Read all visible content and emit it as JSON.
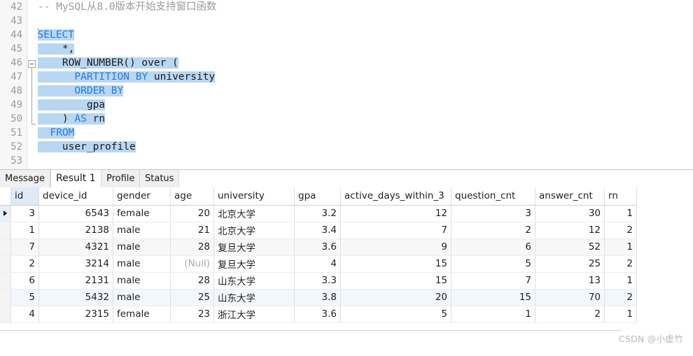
{
  "editor": {
    "lines": [
      {
        "num": "42",
        "indent": 0,
        "selected": false,
        "tokens": [
          {
            "t": "-- MySQL从8.0版本开始支持窗口函数",
            "c": "cmt"
          }
        ]
      },
      {
        "num": "43",
        "indent": 0,
        "selected": false,
        "tokens": []
      },
      {
        "num": "44",
        "indent": 0,
        "selected": true,
        "caret": true,
        "tokens": [
          {
            "t": "SELECT",
            "c": "kw"
          }
        ]
      },
      {
        "num": "45",
        "indent": 0,
        "selected": true,
        "tokens": [
          {
            "t": "    *,",
            "c": "id"
          }
        ]
      },
      {
        "num": "46",
        "indent": 0,
        "selected": true,
        "fold": "start",
        "tokens": [
          {
            "t": "    ROW_NUMBER() over (",
            "c": "id"
          }
        ]
      },
      {
        "num": "47",
        "indent": 0,
        "selected": true,
        "tokens": [
          {
            "t": "      ",
            "c": "id"
          },
          {
            "t": "PARTITION BY",
            "c": "kw"
          },
          {
            "t": " university",
            "c": "id"
          }
        ]
      },
      {
        "num": "48",
        "indent": 0,
        "selected": true,
        "tokens": [
          {
            "t": "      ",
            "c": "id"
          },
          {
            "t": "ORDER BY",
            "c": "kw"
          }
        ]
      },
      {
        "num": "49",
        "indent": 0,
        "selected": true,
        "tokens": [
          {
            "t": "        gpa",
            "c": "id"
          }
        ]
      },
      {
        "num": "50",
        "indent": 0,
        "selected": true,
        "fold": "end",
        "tokens": [
          {
            "t": "    ) ",
            "c": "id"
          },
          {
            "t": "AS",
            "c": "kw"
          },
          {
            "t": " rn",
            "c": "id"
          }
        ]
      },
      {
        "num": "51",
        "indent": 0,
        "selected": true,
        "tokens": [
          {
            "t": "  ",
            "c": "id"
          },
          {
            "t": "FROM",
            "c": "kw"
          }
        ]
      },
      {
        "num": "52",
        "indent": 0,
        "selected": true,
        "tokens": [
          {
            "t": "    user_profile",
            "c": "id"
          }
        ]
      },
      {
        "num": "53",
        "indent": 0,
        "selected": false,
        "tokens": []
      }
    ]
  },
  "tabs": [
    {
      "label": "Message",
      "active": false
    },
    {
      "label": "Result 1",
      "active": true
    },
    {
      "label": "Profile",
      "active": false
    },
    {
      "label": "Status",
      "active": false
    }
  ],
  "grid": {
    "columns": [
      {
        "name": "id",
        "width": 40,
        "align": "num",
        "selected": true
      },
      {
        "name": "device_id",
        "width": 106,
        "align": "num",
        "selected": false
      },
      {
        "name": "gender",
        "width": 82,
        "align": "txt",
        "selected": false
      },
      {
        "name": "age",
        "width": 62,
        "align": "num",
        "selected": false
      },
      {
        "name": "university",
        "width": 115,
        "align": "txt",
        "selected": false
      },
      {
        "name": "gpa",
        "width": 66,
        "align": "num",
        "selected": false
      },
      {
        "name": "active_days_within_3",
        "width": 158,
        "align": "num",
        "selected": false
      },
      {
        "name": "question_cnt",
        "width": 120,
        "align": "num",
        "selected": false
      },
      {
        "name": "answer_cnt",
        "width": 99,
        "align": "num",
        "selected": false
      },
      {
        "name": "rn",
        "width": 46,
        "align": "num",
        "selected": false
      }
    ],
    "rows": [
      {
        "current": true,
        "stripe": "",
        "cells": [
          "3",
          "6543",
          "female",
          "20",
          "北京大学",
          "3.2",
          "12",
          "3",
          "30",
          "1"
        ]
      },
      {
        "current": false,
        "stripe": "",
        "cells": [
          "1",
          "2138",
          "male",
          "21",
          "北京大学",
          "3.4",
          "7",
          "2",
          "12",
          "2"
        ]
      },
      {
        "current": false,
        "stripe": "alt-gray",
        "cells": [
          "7",
          "4321",
          "male",
          "28",
          "复旦大学",
          "3.6",
          "9",
          "6",
          "52",
          "1"
        ]
      },
      {
        "current": false,
        "stripe": "",
        "cells": [
          "2",
          "3214",
          "male",
          "(Null)",
          "复旦大学",
          "4",
          "15",
          "5",
          "25",
          "2"
        ]
      },
      {
        "current": false,
        "stripe": "",
        "cells": [
          "6",
          "2131",
          "male",
          "28",
          "山东大学",
          "3.3",
          "15",
          "7",
          "13",
          "1"
        ]
      },
      {
        "current": false,
        "stripe": "alt-blue",
        "cells": [
          "5",
          "5432",
          "male",
          "25",
          "山东大学",
          "3.8",
          "20",
          "15",
          "70",
          "2"
        ]
      },
      {
        "current": false,
        "stripe": "",
        "cells": [
          "4",
          "2315",
          "female",
          "23",
          "浙江大学",
          "3.6",
          "5",
          "1",
          "2",
          "1"
        ]
      }
    ],
    "null_token": "(Null)"
  },
  "watermark": {
    "text": "CSDN @小虚竹"
  },
  "colors": {
    "selection": "#b9d6f2",
    "keyword": "#1e7bf0",
    "comment": "#9b9b9b",
    "selected_column_header": "#deeaf6",
    "stripe_gray": "#f7f7f7",
    "stripe_blue": "#f2f7fc"
  }
}
